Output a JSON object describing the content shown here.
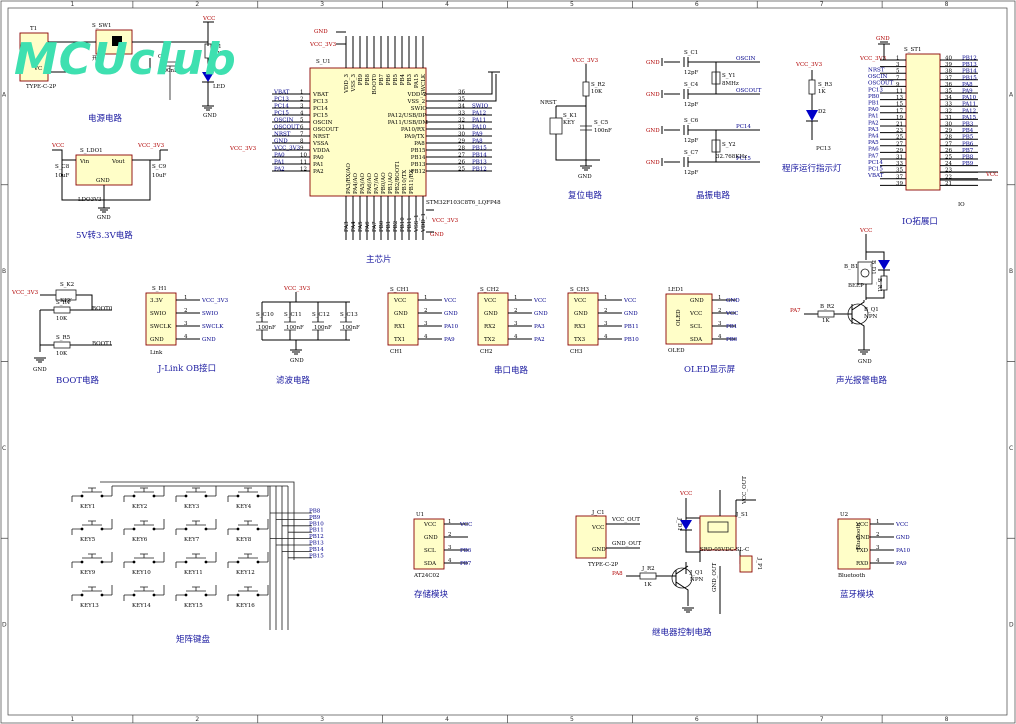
{
  "logo": "MCUclub",
  "zones": {
    "cols": [
      "1",
      "2",
      "3",
      "4",
      "5",
      "6",
      "7",
      "8"
    ],
    "rows": [
      "A",
      "B",
      "C",
      "D"
    ]
  },
  "captions": {
    "power": "电源电路",
    "ldo": "5V转3.3V电路",
    "mcu": "主芯片",
    "reset": "复位电路",
    "crystal": "晶振电路",
    "led": "程序运行指示灯",
    "io": "IO拓展口",
    "boot": "BOOT电路",
    "jlink": "J-Link OB接口",
    "filter": "滤波电路",
    "uart": "串口电路",
    "oled": "OLED显示屏",
    "alarm": "声光报警电路",
    "keypad": "矩阵键盘",
    "storage": "存储模块",
    "relay": "继电器控制电路",
    "bt": "蓝牙模块"
  },
  "power": {
    "t1": "T1",
    "vc": "VC",
    "sw": "S_SW1",
    "sw_label": "开关",
    "usb": "TYPE-C-2P",
    "vcc": "VCC",
    "r1": "R1",
    "r1v": "1K",
    "c2": "C2",
    "c2v": "100nF",
    "led": "LED",
    "gnd": "GND"
  },
  "ldo": {
    "vcc": "VCC",
    "ref": "S_LDO1",
    "vin": "Vin",
    "vout": "Vout",
    "gnd": "GND",
    "c8": "S_C8",
    "c8v": "10uF",
    "c9": "S_C9",
    "c9v": "10uF",
    "v33": "VCC_3V3",
    "part": "LDO3V3"
  },
  "mcu": {
    "ref": "S_U1",
    "part": "STM32F103C8T6_LQFP48",
    "gnd": "GND",
    "v33": "VCC_3V3",
    "left_pins": [
      "VBAT",
      "PC13",
      "PC14",
      "PC15",
      "OSCIN",
      "OSCOUT",
      "NRST",
      "VSSA",
      "VDDA",
      "PA0",
      "PA1",
      "PA2"
    ],
    "left_nets": [
      "VBAT",
      "PC13",
      "PC14",
      "PC15",
      "OSCIN",
      "OSCOUT",
      "NRST",
      "GND",
      "VCC_3V3",
      "PA0",
      "PA1",
      "PA2"
    ],
    "left_nums": [
      "1",
      "2",
      "3",
      "4",
      "5",
      "6",
      "7",
      "8",
      "9",
      "10",
      "11",
      "12"
    ],
    "right_pins": [
      "VDD_2",
      "VSS_2",
      "SWIO",
      "PA12/USB/DP",
      "PA11/USB/DM",
      "PA10/RX",
      "PA9/TX",
      "PA8",
      "PB15",
      "PB14",
      "PB13",
      "PB12"
    ],
    "right_nets": [
      "",
      "",
      "SWIO",
      "PA12",
      "PA11",
      "PA10",
      "PA9",
      "PA8",
      "PB15",
      "PB14",
      "PB13",
      "PB12"
    ],
    "right_nums": [
      "36",
      "35",
      "34",
      "33",
      "32",
      "31",
      "30",
      "29",
      "28",
      "27",
      "26",
      "25"
    ],
    "top_pins": [
      "VDD_3",
      "VSS_3",
      "PB9",
      "PB8",
      "BOOT0",
      "PB7",
      "PB6",
      "PB5",
      "PB4",
      "PB3",
      "PA15",
      "SWCLK"
    ],
    "bottom_pins": [
      "PA3",
      "PA4",
      "PA5",
      "PA6",
      "PA7",
      "PB0",
      "PB1",
      "PB2",
      "PB10",
      "PB11",
      "VSS_1",
      "VDD_1"
    ],
    "inner_left": [
      "PA3/RX/AO",
      "PA4/AO",
      "PA5/AO",
      "PA6/AO",
      "PA7/AO",
      "PB0/AO",
      "PB1/AO",
      "PB2/BOOT1",
      "PB10/TX",
      "PB11/RX"
    ]
  },
  "reset": {
    "v33": "VCC_3V3",
    "r": "S_R2",
    "rv": "10K",
    "nrst": "NRST",
    "key": "S_K1",
    "keyv": "KEY",
    "c": "S_C5",
    "cv": "100nF",
    "gnd": "GND"
  },
  "crystal": {
    "c1": "S_C1",
    "c1v": "12pF",
    "c4": "S_C4",
    "c4v": "12pF",
    "y1": "S_Y1",
    "y1v": "8MHz",
    "oscin": "OSCIN",
    "oscout": "OSCOUT",
    "c6": "S_C6",
    "c6v": "12pF",
    "c7": "S_C7",
    "c7v": "12pF",
    "y2": "S_Y2",
    "y2v": "32.768KHz",
    "pc14": "PC14",
    "pc15": "PC15",
    "gnd": "GND"
  },
  "led": {
    "v33": "VCC_3V3",
    "r": "S_R3",
    "rv": "1K",
    "d": "D2",
    "net": "PC13"
  },
  "io": {
    "ref": "S_ST1",
    "gnd": "GND",
    "v33": "VCC_3V3",
    "vcc": "VCC",
    "left": [
      "NRST",
      "OSCIN",
      "OSCOUT",
      "PC13",
      "PB0",
      "PB1",
      "PA0",
      "PA1",
      "PA2",
      "PA3",
      "PA4",
      "PA5",
      "PA6",
      "PA7",
      "PC14",
      "PC15",
      "VBAT"
    ],
    "right": [
      "PB12",
      "PB13",
      "PB14",
      "PB15",
      "PA8",
      "PA9",
      "PA10",
      "PA11",
      "PA12",
      "PA15",
      "PB3",
      "PB4",
      "PB5",
      "PB6",
      "PB7",
      "PB8",
      "PB9"
    ],
    "part": "IO"
  },
  "boot": {
    "v33": "VCC_3V3",
    "key": "S_K2",
    "keyv": "KEY",
    "r4": "S_R4",
    "r4v": "10K",
    "r5": "S_R5",
    "r5v": "10K",
    "boot0": "BOOT0",
    "boot1": "BOOT1",
    "gnd": "GND"
  },
  "jlink": {
    "ref": "S_H1",
    "pins": [
      "3.3V",
      "SWIO",
      "SWCLK",
      "GND"
    ],
    "nets": [
      "VCC_3V3",
      "SWIO",
      "SWCLK",
      "GND"
    ],
    "part": "Link"
  },
  "filter": {
    "v33": "VCC_3V3",
    "caps": [
      "S_C10",
      "S_C11",
      "S_C12",
      "S_C13"
    ],
    "capv": "100nF",
    "gnd": "GND"
  },
  "uart": [
    {
      "ref": "S_CH1",
      "part": "CH1",
      "rx": "PA10",
      "tx": "PA9"
    },
    {
      "ref": "S_CH2",
      "part": "CH2",
      "rx": "PA3",
      "tx": "PA2"
    },
    {
      "ref": "S_CH3",
      "part": "CH3",
      "rx": "PB11",
      "tx": "PB10"
    }
  ],
  "uart_pins": [
    "VCC",
    "GND",
    "RX1",
    "TX1"
  ],
  "uart_pins2": [
    "VCC",
    "GND",
    "RX2",
    "TX2"
  ],
  "uart_pins3": [
    "VCC",
    "GND",
    "RX3",
    "TX3"
  ],
  "oled": {
    "ref": "LED1",
    "pins": [
      "GND",
      "VCC",
      "SCL",
      "SDA"
    ],
    "nets": [
      "GND",
      "VCC",
      "PB1",
      "PB0"
    ],
    "body": "OLED",
    "part": "OLED"
  },
  "alarm": {
    "vcc": "VCC",
    "b1": "B_B1",
    "b1v": "BEEP",
    "d": "B_D1",
    "r1": "B_R1",
    "r1v": "1K",
    "pa7": "PA7",
    "r2": "B_R2",
    "r2v": "1K",
    "q": "B_Q1",
    "qv": "NPN",
    "gnd": "GND"
  },
  "keypad": {
    "keys": [
      "KEY1",
      "KEY2",
      "KEY3",
      "KEY4",
      "KEY5",
      "KEY6",
      "KEY7",
      "KEY8",
      "KEY9",
      "KEY10",
      "KEY11",
      "KEY12",
      "KEY13",
      "KEY14",
      "KEY15",
      "KEY16"
    ],
    "nets": [
      "PB8",
      "PB9",
      "PB10",
      "PB11",
      "PB12",
      "PB13",
      "PB14",
      "PB15"
    ]
  },
  "storage": {
    "ref": "U1",
    "pins": [
      "VCC",
      "GND",
      "SCL",
      "SDA"
    ],
    "nets": [
      "VCC",
      "",
      "PB6",
      "PB7"
    ],
    "part": "AT24C02"
  },
  "relay": {
    "ref": "J_C1",
    "vcc": "VCC",
    "vcc_out": "VCC_OUT",
    "gnd": "GND",
    "gnd_out": "GND_OUT",
    "part": "TYPE-C-2P",
    "d": "J_D1",
    "s": "J_S1",
    "relay": "SRD-05VDC-SL-C",
    "r": "J_R2",
    "rv": "1K",
    "pa8": "PA8",
    "q": "J_Q1",
    "qv": "NPN",
    "top": "VCC_OUT",
    "side": "GND_OUT",
    "term": "J_P1"
  },
  "bt": {
    "ref": "U2",
    "pins": [
      "VCC",
      "GND",
      "TXD",
      "RXD"
    ],
    "nets": [
      "VCC",
      "GND",
      "PA10",
      "PA9"
    ],
    "body": "Bluetooth",
    "part": "Bluetooth"
  }
}
